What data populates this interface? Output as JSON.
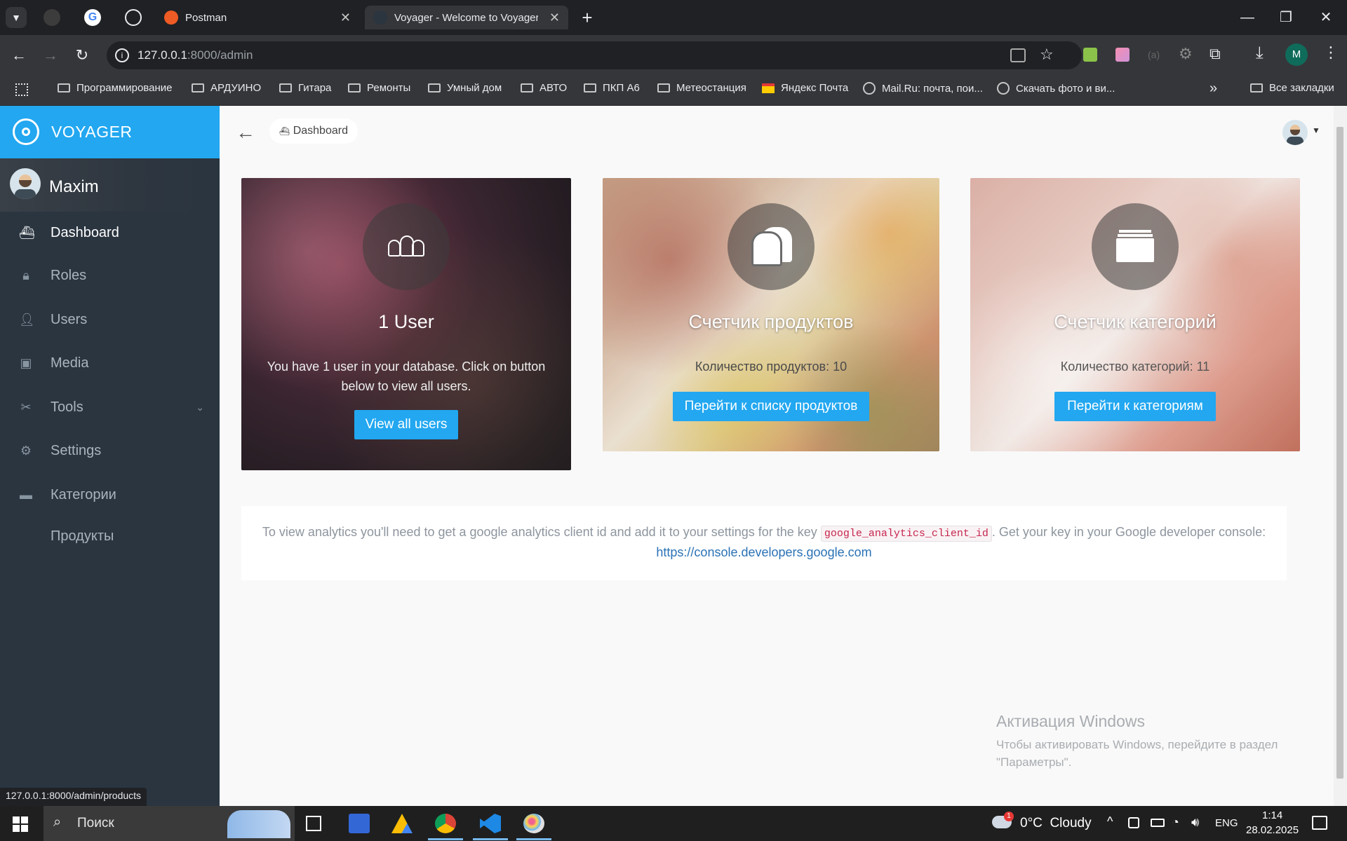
{
  "browser": {
    "tabs": [
      {
        "title": "Postman"
      },
      {
        "title": "Voyager - Welcome to Voyager"
      }
    ],
    "url_host": "127.0.0.1",
    "url_rest": ":8000/admin",
    "profile_initial": "M",
    "bookmarks": [
      "Программирование",
      "АРДУИНО",
      "Гитара",
      "Ремонты",
      "Умный дом",
      "АВТО",
      "ПКП А6",
      "Метеостанция",
      "Яндекс Почта",
      "Mail.Ru: почта, пои...",
      "Скачать фото и ви...",
      "Все закладки"
    ],
    "status_url": "127.0.0.1:8000/admin/products"
  },
  "sidebar": {
    "brand": "VOYAGER",
    "user": "Maxim",
    "items": [
      {
        "label": "Dashboard",
        "icon": "boat-icon"
      },
      {
        "label": "Roles",
        "icon": "lock-icon"
      },
      {
        "label": "Users",
        "icon": "person-icon"
      },
      {
        "label": "Media",
        "icon": "images-icon"
      },
      {
        "label": "Tools",
        "icon": "tools-icon"
      },
      {
        "label": "Settings",
        "icon": "gear-icon"
      },
      {
        "label": "Категории",
        "icon": "folder-icon"
      },
      {
        "label": "Продукты",
        "icon": ""
      }
    ]
  },
  "breadcrumb": {
    "label": "Dashboard"
  },
  "cards": [
    {
      "title": "1 User",
      "text": "You have 1 user in your database. Click on button below to view all users.",
      "button": "View all users",
      "icon": "users-icon"
    },
    {
      "title": "Счетчик продуктов",
      "text": "Количество продуктов: 10",
      "button": "Перейти к списку продуктов",
      "icon": "bread-icon"
    },
    {
      "title": "Счетчик категорий",
      "text": "Количество категорий: 11",
      "button": "Перейти к категориям",
      "icon": "folder-icon"
    }
  ],
  "analytics": {
    "text_before": "To view analytics you'll need to get a google analytics client id and add it to your settings for the key ",
    "key": "google_analytics_client_id",
    "text_after": ". Get your key in your Google developer console:",
    "link": "https://console.developers.google.com"
  },
  "windows_activation": {
    "title": "Активация Windows",
    "text": "Чтобы активировать Windows, перейдите в раздел \"Параметры\"."
  },
  "taskbar": {
    "search": "Поиск",
    "weather": "0°C  Cloudy",
    "weather_badge": "1",
    "lang": "ENG",
    "time": "1:14",
    "date": "28.02.2025"
  },
  "colors": {
    "accent": "#22a7f0",
    "sidebar": "#2a3540"
  }
}
